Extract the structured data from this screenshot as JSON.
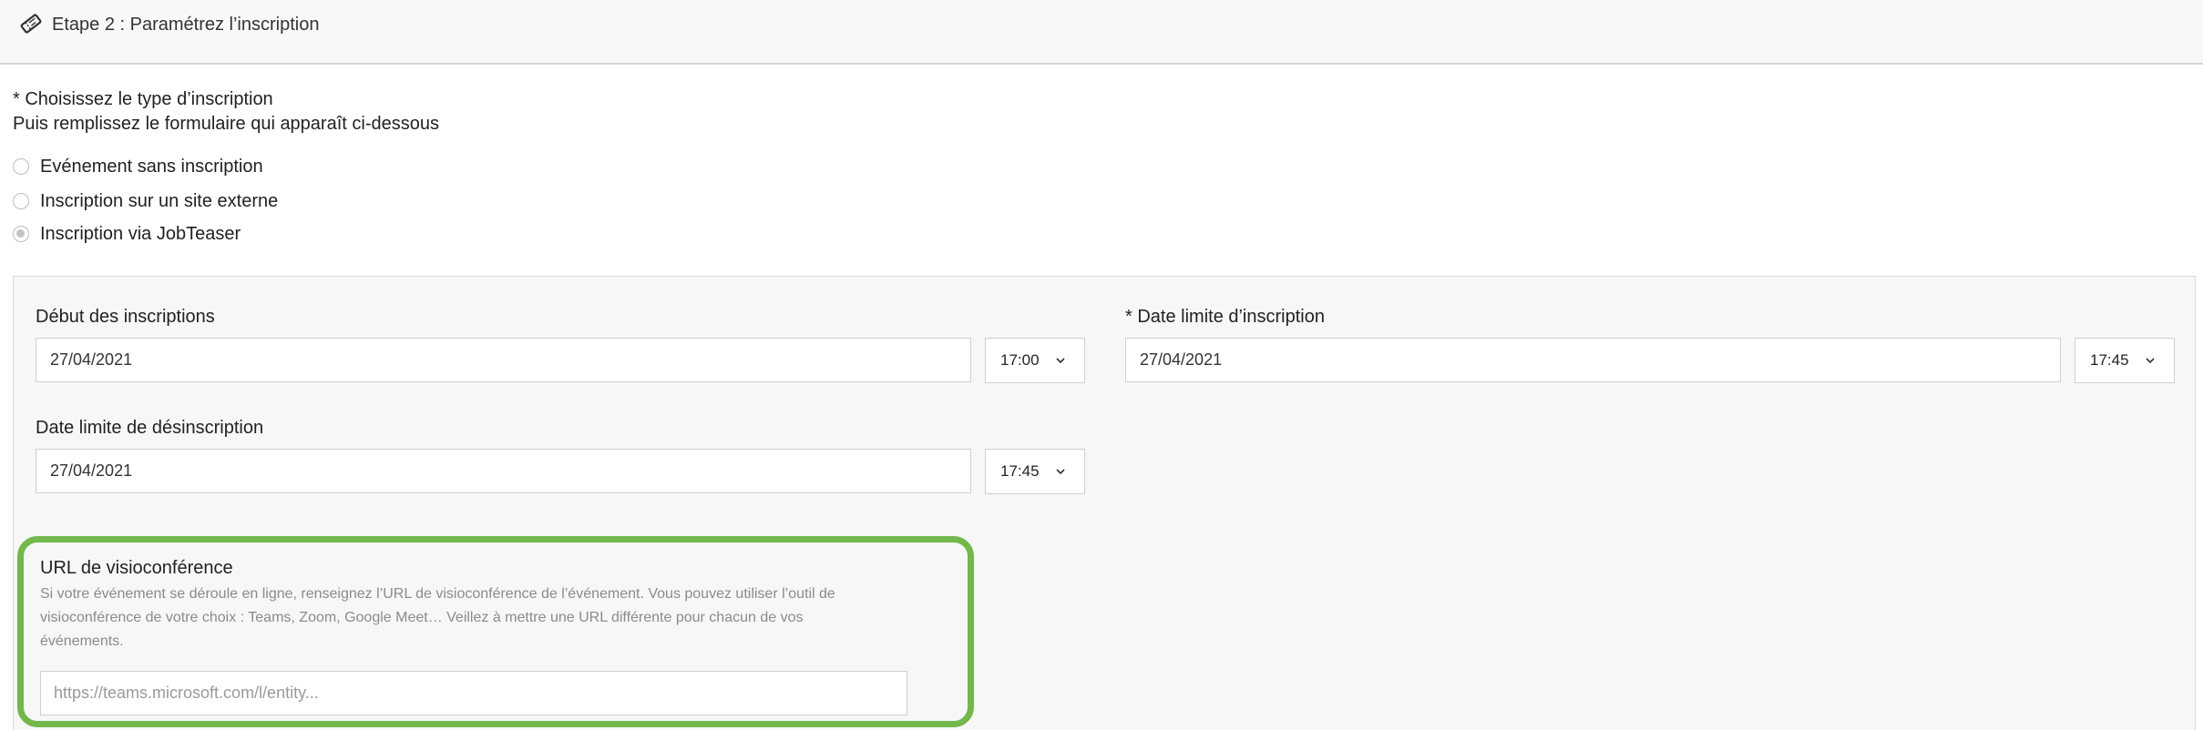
{
  "header": {
    "title": "Etape 2 : Paramétrez l’inscription",
    "icon": "ticket-icon"
  },
  "registration_type": {
    "title": "* Choisissez le type d’inscription",
    "subtitle": "Puis remplissez le formulaire qui apparaît ci-dessous",
    "options": [
      {
        "label": "Evénement sans inscription",
        "selected": false
      },
      {
        "label": "Inscription sur un site externe",
        "selected": false
      },
      {
        "label": "Inscription via JobTeaser",
        "selected": true
      }
    ]
  },
  "form": {
    "start": {
      "label": "Début des inscriptions",
      "date": "27/04/2021",
      "time": "17:00"
    },
    "deadline": {
      "label": "* Date limite d’inscription",
      "date": "27/04/2021",
      "time": "17:45"
    },
    "unsubscribe": {
      "label": "Date limite de désinscription",
      "date": "27/04/2021",
      "time": "17:45"
    },
    "visio": {
      "label": "URL de visioconférence",
      "help": "Si votre événement se déroule en ligne, renseignez l’URL de visioconférence de l’événement. Vous pouvez utiliser l’outil de visioconférence de votre choix : Teams, Zoom, Google Meet… Veillez à mettre une URL différente pour chacun de vos événements.",
      "placeholder": "https://teams.microsoft.com/l/entity...",
      "value": ""
    }
  },
  "colors": {
    "highlight": "#72b84a",
    "panel_bg": "#f7f7f7"
  }
}
